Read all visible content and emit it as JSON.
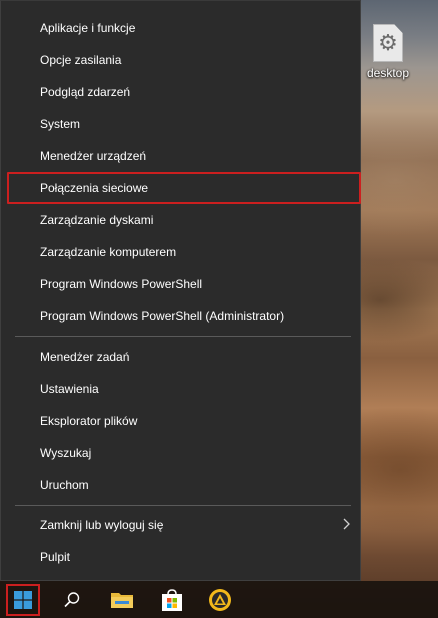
{
  "desktop": {
    "icon_label": "desktop",
    "icon_name": "gear-file-icon"
  },
  "menu": {
    "group1": [
      {
        "label": "Aplikacje i funkcje"
      },
      {
        "label": "Opcje zasilania"
      },
      {
        "label": "Podgląd zdarzeń"
      },
      {
        "label": "System"
      },
      {
        "label": "Menedżer urządzeń"
      },
      {
        "label": "Połączenia sieciowe",
        "selected": true
      },
      {
        "label": "Zarządzanie dyskami"
      },
      {
        "label": "Zarządzanie komputerem"
      },
      {
        "label": "Program Windows PowerShell"
      },
      {
        "label": "Program Windows PowerShell (Administrator)"
      }
    ],
    "group2": [
      {
        "label": "Menedżer zadań"
      },
      {
        "label": "Ustawienia"
      },
      {
        "label": "Eksplorator plików"
      },
      {
        "label": "Wyszukaj"
      },
      {
        "label": "Uruchom"
      }
    ],
    "group3": [
      {
        "label": "Zamknij lub wyloguj się",
        "submenu": true
      },
      {
        "label": "Pulpit"
      }
    ],
    "highlight_color": "#cc1f1f",
    "background_color": "#2b2b2b"
  },
  "taskbar": {
    "icons": [
      "windows-start-icon",
      "search-icon",
      "file-explorer-icon",
      "microsoft-store-icon",
      "aimp-icon"
    ]
  }
}
